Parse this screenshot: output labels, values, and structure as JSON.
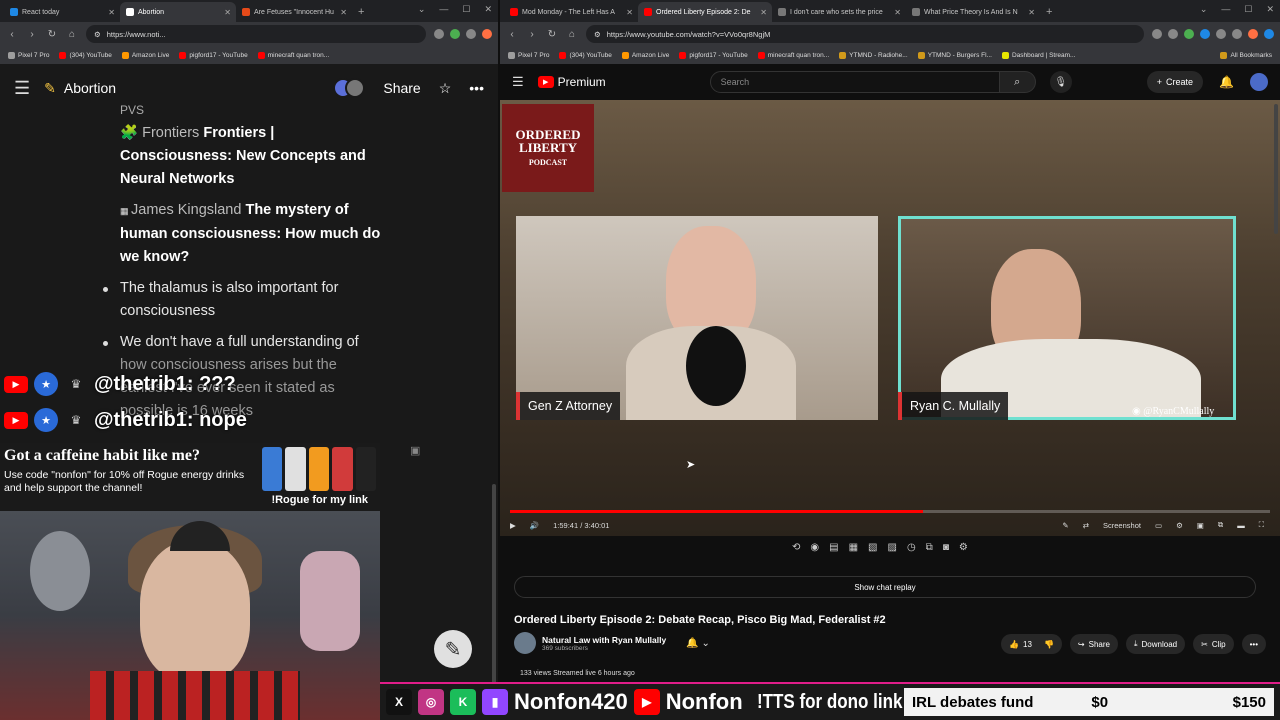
{
  "left_browser": {
    "tabs": [
      {
        "title": "React today",
        "active": false,
        "color": "#1e88e5"
      },
      {
        "title": "Abortion",
        "active": true,
        "color": "#ffffff"
      },
      {
        "title": "Are Fetuses \"Innocent Hu",
        "active": false,
        "color": "#e64a19"
      }
    ],
    "url": "https://www.noti...",
    "bookmarks": [
      "Pixel 7 Pro",
      "(304) YouTube",
      "Amazon Live",
      "pigford17 - YouTube",
      "minecraft quan tron..."
    ]
  },
  "notion": {
    "page_title": "Abortion",
    "share_label": "Share",
    "cut_line": "PVS",
    "refs": [
      {
        "source": "Frontiers",
        "title": "Frontiers | Consciousness: New Concepts and Neural Networks"
      },
      {
        "source": "James Kingsland",
        "title": "The mystery of human consciousness: How much do we know?"
      }
    ],
    "bullets": [
      "The thalamus is also important for consciousness",
      "We don't have a full understanding of"
    ],
    "faded_lines": [
      "how consciousness arises but the",
      "earliest I've ever seen it stated as",
      "possible is 16 weeks"
    ]
  },
  "stream_overlay": {
    "chat": [
      {
        "user": "@thetrib1",
        "message": "???"
      },
      {
        "user": "@thetrib1",
        "message": "nope"
      }
    ],
    "promo_heading": "Got a caffeine habit like me?",
    "promo_sub": "Use code \"nonfon\" for 10% off Rogue energy drinks and help support the channel!",
    "promo_cta": "!Rogue for my link",
    "ticker": {
      "handle1": "Nonfon420",
      "handle2": "Nonfon",
      "tts": "!TTS for dono link",
      "fund_label": "IRL debates fund",
      "fund_current": "$0",
      "fund_goal": "$150"
    }
  },
  "right_browser": {
    "tabs": [
      {
        "title": "Mod Monday - The Left Has A",
        "active": false,
        "color": "#ff0000"
      },
      {
        "title": "Ordered Liberty Episode 2: De",
        "active": true,
        "color": "#ff0000"
      },
      {
        "title": "I don't care who sets the price",
        "active": false,
        "color": "#777777"
      },
      {
        "title": "What Price Theory Is And Is N",
        "active": false,
        "color": "#777777"
      }
    ],
    "url": "https://www.youtube.com/watch?v=VVo0qr8NgjM",
    "bookmarks": [
      "Pixel 7 Pro",
      "(304) YouTube",
      "Amazon Live",
      "pigford17 - YouTube",
      "minecraft quan tron...",
      "YTMND - Radiohe...",
      "YTMND - Burgers Fl...",
      "Dashboard | Stream..."
    ],
    "all_bookmarks": "All Bookmarks"
  },
  "youtube": {
    "brand": "Premium",
    "search_placeholder": "Search",
    "create_label": "Create",
    "channel_logo_text": "ORDERED LIBERTY",
    "channel_logo_sub": "PODCAST",
    "cam1_name": "Gen Z Attorney",
    "cam2_name": "Ryan C. Mullally",
    "cam2_handle": "@RyanCMullally",
    "time": "1:59:41 / 3:40:01",
    "progress_fraction": 0.544,
    "screenshot_label": "Screenshot",
    "chat_replay": "Show chat replay",
    "video_title": "Ordered Liberty Episode 2: Debate Recap, Pisco Big Mad, Federalist #2",
    "channel_name": "Natural Law with Ryan Mullally",
    "subscribers": "369 subscribers",
    "likes": "13",
    "share": "Share",
    "download": "Download",
    "clip": "Clip",
    "meta": "133 views  Streamed live 6 hours ago"
  }
}
